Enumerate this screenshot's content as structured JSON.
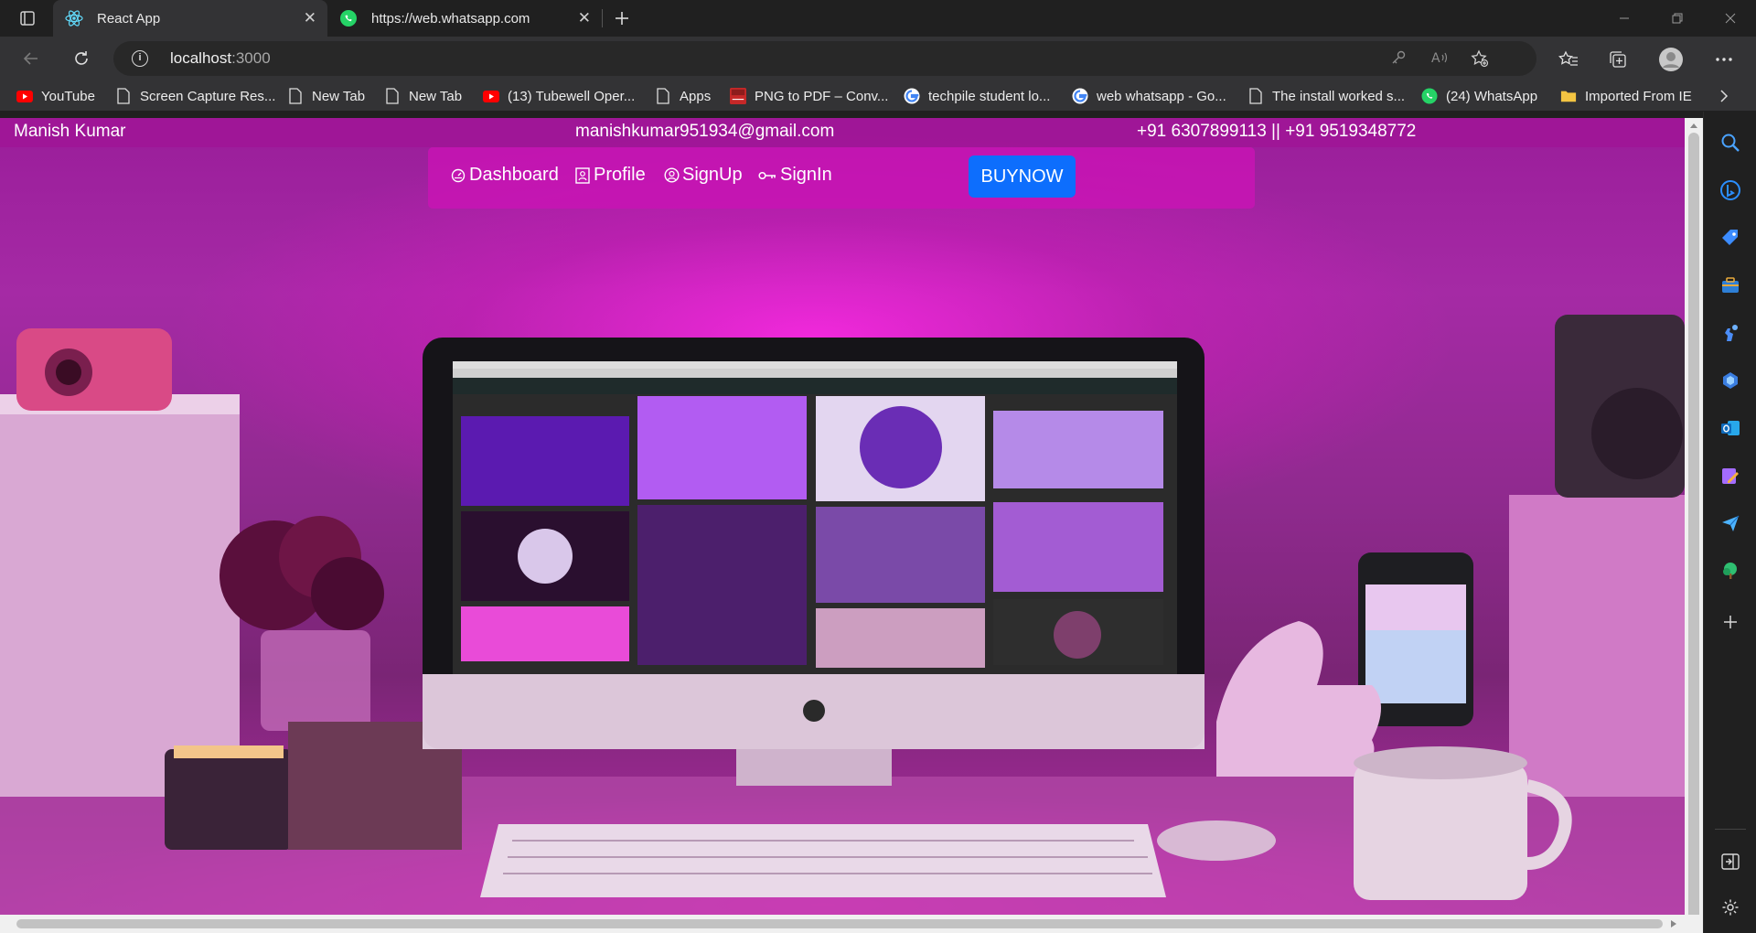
{
  "browser": {
    "tabs": [
      {
        "title": "React App",
        "active": true,
        "icon": "react-icon"
      },
      {
        "title": "https://web.whatsapp.com",
        "active": false,
        "icon": "whatsapp-icon"
      }
    ],
    "address": {
      "host": "localhost",
      "port": ":3000"
    },
    "bookmarks": [
      {
        "label": "YouTube",
        "icon": "youtube-icon"
      },
      {
        "label": "Screen Capture Res...",
        "icon": "page-icon"
      },
      {
        "label": "New Tab",
        "icon": "page-icon"
      },
      {
        "label": "New Tab",
        "icon": "page-icon"
      },
      {
        "label": "(13) Tubewell Oper...",
        "icon": "youtube-icon"
      },
      {
        "label": "Apps",
        "icon": "page-icon"
      },
      {
        "label": "PNG to PDF – Conv...",
        "icon": "png-pdf-icon"
      },
      {
        "label": "techpile student lo...",
        "icon": "google-icon"
      },
      {
        "label": "web whatsapp - Go...",
        "icon": "google-icon"
      },
      {
        "label": "The install worked s...",
        "icon": "page-icon"
      },
      {
        "label": "(24) WhatsApp",
        "icon": "whatsapp-icon"
      },
      {
        "label": "Imported From IE",
        "icon": "folder-icon"
      }
    ],
    "sidebar_icons": [
      "search-icon",
      "bing-icon",
      "tag-icon",
      "briefcase-icon",
      "games-icon",
      "copilot-icon",
      "outlook-icon",
      "designer-icon",
      "send-icon",
      "tree-icon",
      "add-icon",
      "split-screen-icon",
      "settings-icon"
    ]
  },
  "page": {
    "topbar": {
      "name": "Manish Kumar",
      "email": "manishkumar951934@gmail.com",
      "phone": "+91 6307899113 || +91 9519348772"
    },
    "nav": [
      {
        "label": "Dashboard",
        "icon": "dashboard-icon"
      },
      {
        "label": "Profile",
        "icon": "profile-icon"
      },
      {
        "label": "SignUp",
        "icon": "user-circle-icon"
      },
      {
        "label": "SignIn",
        "icon": "key-icon"
      }
    ],
    "buy_label": "BUYNOW",
    "colors": {
      "topbar": "#a01496",
      "navcard": "#c814b4",
      "buy_button": "#0d6efd",
      "background": "#9a1d9a"
    }
  }
}
